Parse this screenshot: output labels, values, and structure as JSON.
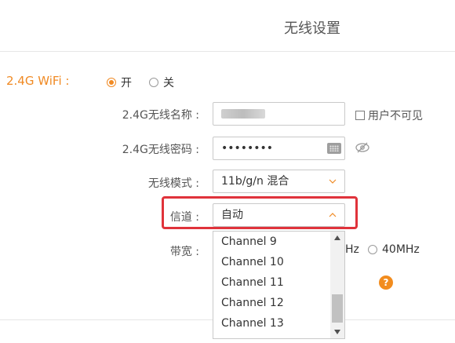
{
  "title": "无线设置",
  "wifi_24g": {
    "label": "2.4G WiFi :",
    "on_label": "开",
    "off_label": "关",
    "selected": "on"
  },
  "ssid": {
    "label": "2.4G无线名称 :",
    "value": "",
    "hide_label": "用户不可见"
  },
  "password": {
    "label": "2.4G无线密码 :",
    "value": "••••••••"
  },
  "mode": {
    "label": "无线模式 :",
    "value": "11b/g/n 混合"
  },
  "channel": {
    "label": "信道 :",
    "value": "自动",
    "options": [
      "Channel 9",
      "Channel 10",
      "Channel 11",
      "Channel 12",
      "Channel 13"
    ]
  },
  "bandwidth": {
    "label": "带宽 :",
    "partial_option": "Hz",
    "option_40": "40MHz"
  },
  "help_glyph": "?",
  "colors": {
    "accent": "#f08a24",
    "highlight_border": "#e0333b"
  }
}
